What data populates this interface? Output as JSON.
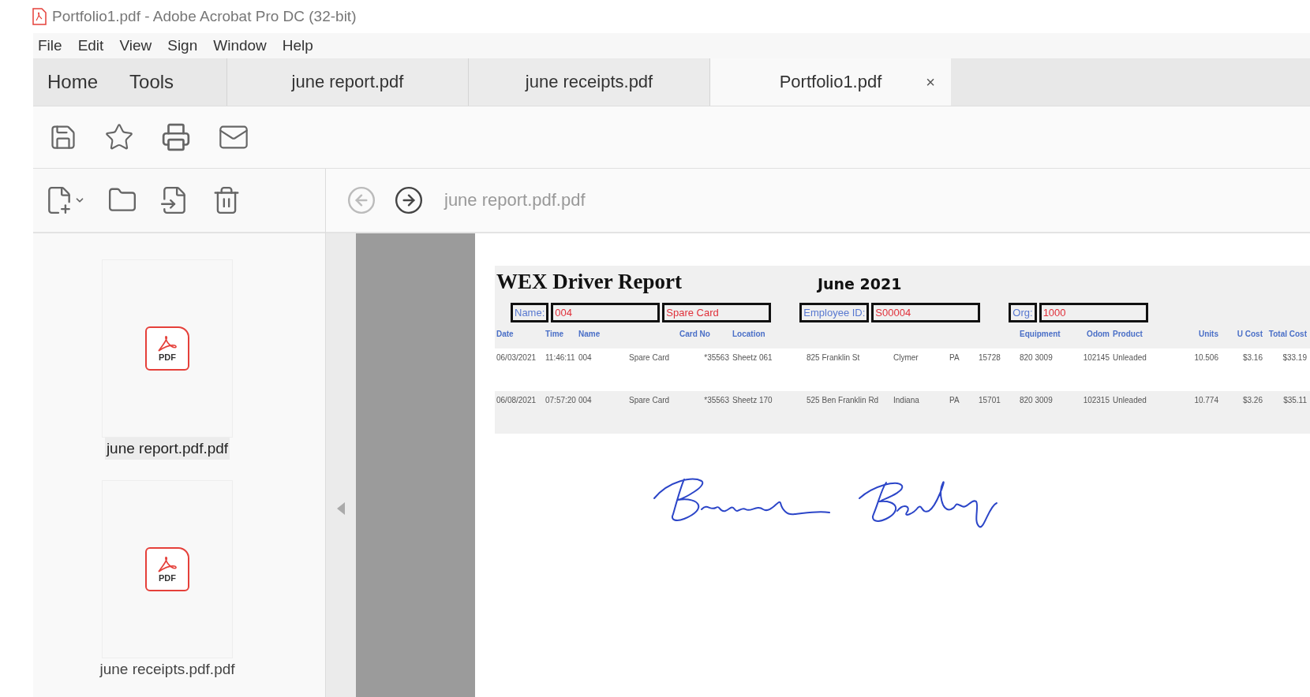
{
  "window": {
    "title": "Portfolio1.pdf - Adobe Acrobat Pro DC (32-bit)"
  },
  "menu": [
    "File",
    "Edit",
    "View",
    "Sign",
    "Window",
    "Help"
  ],
  "nav_tabs": [
    {
      "label": "Home",
      "selected": false
    },
    {
      "label": "Tools",
      "selected": false
    }
  ],
  "document_tabs": [
    {
      "label": "june report.pdf",
      "selected": false
    },
    {
      "label": "june receipts.pdf",
      "selected": false
    },
    {
      "label": "Portfolio1.pdf",
      "selected": true,
      "close": "×"
    }
  ],
  "navigation": {
    "buttons": [
      {
        "kind": "back",
        "disabled": true
      },
      {
        "kind": "forward",
        "disabled": false
      }
    ],
    "current_file": "june report.pdf.pdf"
  },
  "files": [
    {
      "name": "june report.pdf.pdf",
      "type_label": "PDF",
      "selected": true
    },
    {
      "name": "june receipts.pdf.pdf",
      "type_label": "PDF",
      "selected": false
    }
  ],
  "report": {
    "title": "WEX Driver Report",
    "month": "June 2021",
    "fields": [
      {
        "label": "Name:",
        "values": [
          "004",
          "Spare Card"
        ]
      },
      {
        "label": "Employee ID:",
        "values": [
          "S00004"
        ]
      },
      {
        "label": "Org:",
        "values": [
          "1000"
        ]
      }
    ],
    "columns": [
      "Date",
      "Time",
      "Name",
      "",
      "Card No",
      "Location",
      "",
      "",
      "",
      "",
      "Equipment",
      "Odom",
      "Product",
      "Units",
      "U Cost",
      "Total Cost"
    ],
    "rows": [
      [
        "06/03/2021",
        "11:46:11",
        "004",
        "Spare Card",
        "*35563",
        "Sheetz 061",
        "825 Franklin St",
        "Clymer",
        "PA",
        "15728",
        "820 3009",
        "102145",
        "Unleaded",
        "10.506",
        "$3.16",
        "$33.19"
      ],
      [
        "06/08/2021",
        "07:57:20",
        "004",
        "Spare Card",
        "*35563",
        "Sheetz 170",
        "525 Ben Franklin Rd",
        "Indiana",
        "PA",
        "15701",
        "820 3009",
        "102315",
        "Unleaded",
        "10.774",
        "$3.26",
        "$35.11"
      ]
    ]
  }
}
